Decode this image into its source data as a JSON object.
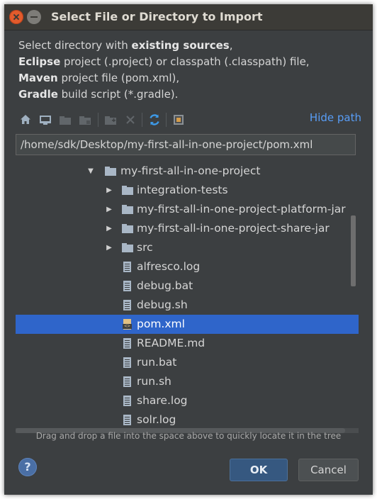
{
  "window": {
    "title": "Select File or Directory to Import"
  },
  "description": {
    "line1_pre": "Select directory with ",
    "line1_bold": "existing sources",
    "line1_post": ",",
    "line2_bold": "Eclipse",
    "line2_post": " project (.project) or classpath (.classpath) file,",
    "line3_bold": "Maven",
    "line3_post": " project file (pom.xml),",
    "line4_bold": "Gradle",
    "line4_post": " build script (*.gradle)."
  },
  "toolbar": {
    "icons": [
      "home-icon",
      "desktop-icon",
      "project-folder-icon",
      "module-folder-icon",
      "new-folder-icon",
      "delete-icon",
      "refresh-icon",
      "show-hidden-icon"
    ],
    "hide_path_label": "Hide path"
  },
  "path_field": {
    "value": "/home/sdk/Desktop/my-first-all-in-one-project/pom.xml"
  },
  "tree": {
    "items": [
      {
        "label": "my-first-all-in-one-project",
        "type": "folder",
        "expanded": true,
        "selected": false
      },
      {
        "label": "integration-tests",
        "type": "folder",
        "expanded": false,
        "selected": false
      },
      {
        "label": "my-first-all-in-one-project-platform-jar",
        "type": "folder",
        "expanded": false,
        "selected": false
      },
      {
        "label": "my-first-all-in-one-project-share-jar",
        "type": "folder",
        "expanded": false,
        "selected": false
      },
      {
        "label": "src",
        "type": "folder",
        "expanded": false,
        "selected": false
      },
      {
        "label": "alfresco.log",
        "type": "file",
        "selected": false
      },
      {
        "label": "debug.bat",
        "type": "file",
        "selected": false
      },
      {
        "label": "debug.sh",
        "type": "file",
        "selected": false
      },
      {
        "label": "pom.xml",
        "type": "xml",
        "selected": true
      },
      {
        "label": "README.md",
        "type": "file",
        "selected": false
      },
      {
        "label": "run.bat",
        "type": "file",
        "selected": false
      },
      {
        "label": "run.sh",
        "type": "file",
        "selected": false
      },
      {
        "label": "share.log",
        "type": "file",
        "selected": false
      },
      {
        "label": "solr.log",
        "type": "file",
        "selected": false
      }
    ]
  },
  "hint": "Drag and drop a file into the space above to quickly locate it in the tree",
  "buttons": {
    "help": "?",
    "ok": "OK",
    "cancel": "Cancel"
  },
  "colors": {
    "background": "#3c3f41",
    "selection": "#2f65ca",
    "link": "#589df6",
    "close_button": "#e35b2c"
  }
}
